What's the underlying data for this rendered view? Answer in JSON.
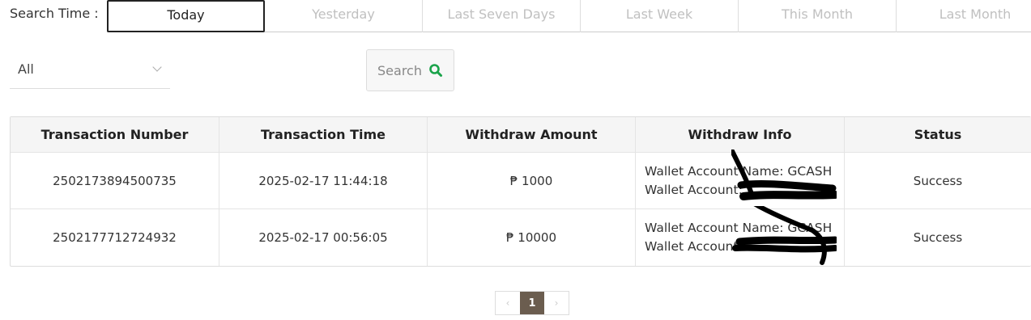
{
  "search_time_label": "Search Time :",
  "tabs": [
    {
      "label": "Today",
      "active": true
    },
    {
      "label": "Yesterday",
      "active": false
    },
    {
      "label": "Last Seven Days",
      "active": false
    },
    {
      "label": "Last Week",
      "active": false
    },
    {
      "label": "This Month",
      "active": false
    },
    {
      "label": "Last Month",
      "active": false
    }
  ],
  "filter": {
    "value": "All"
  },
  "search_button": {
    "label": "Search",
    "icon": "search-icon"
  },
  "table": {
    "headers": [
      "Transaction Number",
      "Transaction Time",
      "Withdraw Amount",
      "Withdraw Info",
      "Status"
    ],
    "rows": [
      {
        "number": "2502173894500735",
        "time": "2025-02-17 11:44:18",
        "amount": "₱ 1000",
        "info_line1": "Wallet Account Name: GCASH",
        "info_line2": "Wallet Account:",
        "status": "Success"
      },
      {
        "number": "2502177712724932",
        "time": "2025-02-17 00:56:05",
        "amount": "₱ 10000",
        "info_line1": "Wallet Account Name: GCASH",
        "info_line2": "Wallet Account:",
        "status": "Success"
      }
    ]
  },
  "pagination": {
    "prev": "‹",
    "current": "1",
    "next": "›"
  },
  "colors": {
    "active_page": "#6b5d4f",
    "search_icon": "#1aa34a"
  }
}
